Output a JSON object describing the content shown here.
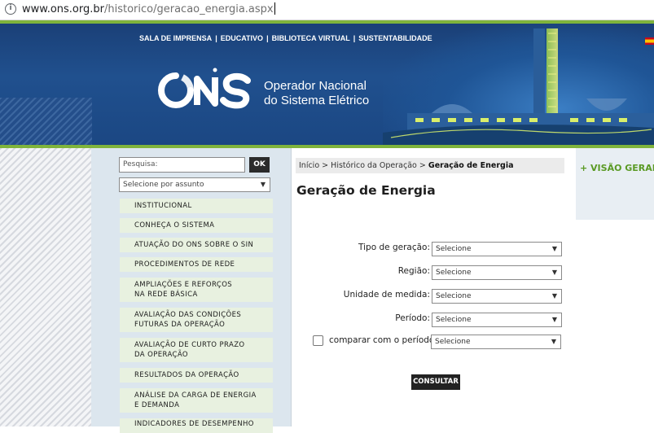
{
  "browser": {
    "url_host": "www.ons.org.br",
    "url_path": "/historico/geracao_energia.aspx"
  },
  "header": {
    "nav": [
      "SALA DE IMPRENSA",
      "EDUCATIVO",
      "BIBLIOTECA VIRTUAL",
      "SUSTENTABILIDADE"
    ],
    "nav_separator": "|",
    "logo_text_line1": "Operador Nacional",
    "logo_text_line2": "do Sistema Elétrico",
    "colors": {
      "banner": "#1f4f8c",
      "accent_green": "#7fb43c"
    }
  },
  "sidebar": {
    "search_placeholder": "Pesquisa:",
    "search_button": "OK",
    "subject_select": "Selecione por assunto",
    "items": [
      {
        "line1": "INSTITUCIONAL",
        "line2": ""
      },
      {
        "line1": "CONHEÇA O SISTEMA",
        "line2": ""
      },
      {
        "line1": "ATUAÇÃO DO ONS SOBRE O SIN",
        "line2": ""
      },
      {
        "line1": "PROCEDIMENTOS DE REDE",
        "line2": ""
      },
      {
        "line1": "AMPLIAÇÕES E REFORÇOS",
        "line2": "NA REDE BÁSICA"
      },
      {
        "line1": "AVALIAÇÃO DAS CONDIÇÕES",
        "line2": "FUTURAS DA OPERAÇÃO"
      },
      {
        "line1": "AVALIAÇÃO DE CURTO PRAZO",
        "line2": "DA OPERAÇÃO"
      },
      {
        "line1": "RESULTADOS DA OPERAÇÃO",
        "line2": ""
      },
      {
        "line1": "ANÁLISE DA CARGA DE ENERGIA",
        "line2": "E DEMANDA"
      },
      {
        "line1": "INDICADORES DE DESEMPENHO",
        "line2": ""
      }
    ]
  },
  "breadcrumb": {
    "home": "Início",
    "sep": ">",
    "section": "Histórico da Operação",
    "current": "Geração de Energia"
  },
  "main": {
    "title": "Geração de Energia",
    "fields": [
      {
        "label": "Tipo de geração:",
        "value": "Selecione"
      },
      {
        "label": "Região:",
        "value": "Selecione"
      },
      {
        "label": "Unidade de medida:",
        "value": "Selecione"
      },
      {
        "label": "Período:",
        "value": "Selecione"
      }
    ],
    "compare_label": "comparar com o período:",
    "compare_value": "Selecione",
    "compare_checked": false,
    "submit": "CONSULTAR"
  },
  "right_panel": {
    "link": "+ VISÃO GERAL"
  }
}
